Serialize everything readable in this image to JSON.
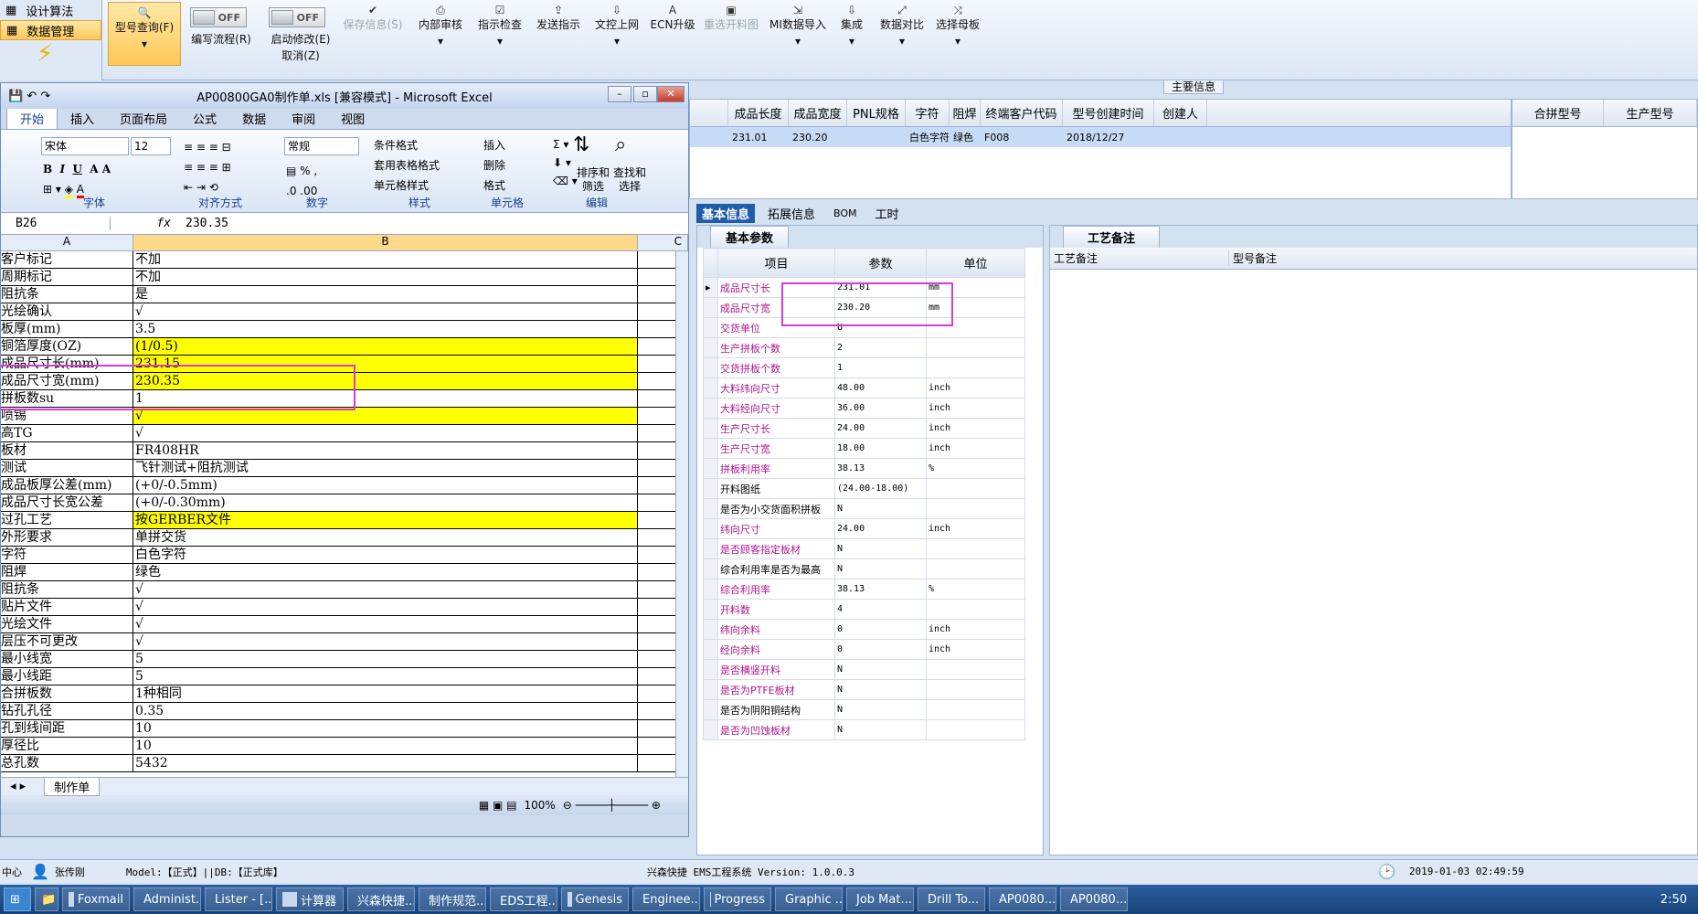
{
  "nav": {
    "items": [
      {
        "label": "设计算法"
      },
      {
        "label": "数据管理"
      }
    ]
  },
  "ribbon": {
    "query": "型号查询(F)",
    "write_flow": "编写流程(R)",
    "start_modify": "启动修改(E)",
    "cancel": "取消(Z)",
    "off": "OFF",
    "save": "保存信息(S)",
    "internal_review": "内部审核",
    "guide_check": "指示检查",
    "send_guide": "发送指示",
    "upload": "文控上网",
    "ecn": "ECN升级",
    "resend": "重选开料图",
    "mi_import": "MI数据导入",
    "integrate": "集成",
    "compare": "数据对比",
    "mother": "选择母板"
  },
  "main_info": "主要信息",
  "top_grid": {
    "headers": [
      "成品长度",
      "成品宽度",
      "PNL规格",
      "字符",
      "阻焊",
      "终端客户代码",
      "型号创建时间",
      "创建人"
    ],
    "row": [
      "231.01",
      "230.20",
      "",
      "白色字符",
      "绿色",
      "F008",
      "2018/12/27",
      ""
    ],
    "right_headers": [
      "合拼型号",
      "生产型号"
    ]
  },
  "tabs": [
    "基本信息",
    "拓展信息",
    "BOM",
    "工时"
  ],
  "basic": {
    "caption": "基本参数",
    "headers": [
      "项目",
      "参数",
      "单位"
    ],
    "rows": [
      {
        "k": "成品尺寸长",
        "v": "231.01",
        "u": "mm",
        "c": "p"
      },
      {
        "k": "成品尺寸宽",
        "v": "230.20",
        "u": "mm",
        "c": "p"
      },
      {
        "k": "交货单位",
        "v": "U",
        "u": "",
        "c": "p"
      },
      {
        "k": "生产拼板个数",
        "v": "2",
        "u": "",
        "c": "p"
      },
      {
        "k": "交货拼板个数",
        "v": "1",
        "u": "",
        "c": "p"
      },
      {
        "k": "大料纬向尺寸",
        "v": "48.00",
        "u": "inch",
        "c": "p"
      },
      {
        "k": "大料经向尺寸",
        "v": "36.00",
        "u": "inch",
        "c": "p"
      },
      {
        "k": "生产尺寸长",
        "v": "24.00",
        "u": "inch",
        "c": "p"
      },
      {
        "k": "生产尺寸宽",
        "v": "18.00",
        "u": "inch",
        "c": "p"
      },
      {
        "k": "拼板利用率",
        "v": "38.13",
        "u": "%",
        "c": "p"
      },
      {
        "k": "开料图纸",
        "v": "(24.00-18.00)",
        "u": "",
        "c": "b"
      },
      {
        "k": "是否为小交货面积拼板",
        "v": "N",
        "u": "",
        "c": "b"
      },
      {
        "k": "纬向尺寸",
        "v": "24.00",
        "u": "inch",
        "c": "p"
      },
      {
        "k": "是否顾客指定板材",
        "v": "N",
        "u": "",
        "c": "p"
      },
      {
        "k": "综合利用率是否为最高",
        "v": "N",
        "u": "",
        "c": "b"
      },
      {
        "k": "综合利用率",
        "v": "38.13",
        "u": "%",
        "c": "p"
      },
      {
        "k": "开料数",
        "v": "4",
        "u": "",
        "c": "p"
      },
      {
        "k": "纬向余料",
        "v": "0",
        "u": "inch",
        "c": "p"
      },
      {
        "k": "经向余料",
        "v": "0",
        "u": "inch",
        "c": "p"
      },
      {
        "k": "是否横竖开料",
        "v": "N",
        "u": "",
        "c": "p"
      },
      {
        "k": "是否为PTFE板材",
        "v": "N",
        "u": "",
        "c": "p"
      },
      {
        "k": "是否为阴阳铜结构",
        "v": "N",
        "u": "",
        "c": "b"
      },
      {
        "k": "是否为凹蚀板材",
        "v": "N",
        "u": "",
        "c": "p"
      }
    ]
  },
  "process": {
    "caption": "工艺备注",
    "col1": "工艺备注",
    "col2": "型号备注"
  },
  "excel": {
    "title": "AP00800GA0制作单.xls [兼容模式] - Microsoft Excel",
    "tabs": [
      "开始",
      "插入",
      "页面布局",
      "公式",
      "数据",
      "审阅",
      "视图"
    ],
    "font": "宋体",
    "size": "12",
    "format": "常规",
    "groups": [
      "字体",
      "对齐方式",
      "数字",
      "样式",
      "单元格",
      "编辑"
    ],
    "style_items": [
      "条件格式",
      "套用表格格式",
      "单元格样式"
    ],
    "cell_items": [
      "插入",
      "删除",
      "格式"
    ],
    "edit_items": [
      "排序和筛选",
      "查找和选择"
    ],
    "namebox": "B26",
    "fx": "fx",
    "formula": "230.35",
    "cols": [
      "A",
      "B",
      "C"
    ],
    "rows": [
      {
        "a": "客户标记",
        "b": "不加",
        "y": false
      },
      {
        "a": "周期标记",
        "b": "不加",
        "y": false
      },
      {
        "a": "阻抗条",
        "b": "是",
        "y": false
      },
      {
        "a": "光绘确认",
        "b": "√",
        "y": false
      },
      {
        "a": "板厚(mm)",
        "b": "3.5",
        "y": false
      },
      {
        "a": "铜箔厚度(OZ)",
        "b": " (1/0.5)",
        "y": true
      },
      {
        "a": "成品尺寸长(mm)",
        "b": "231.15",
        "y": true
      },
      {
        "a": "成品尺寸宽(mm)",
        "b": "230.35",
        "y": true
      },
      {
        "a": "拼板数su",
        "b": "1",
        "y": false
      },
      {
        "a": "喷锡",
        "b": "√",
        "y": true
      },
      {
        "a": "高TG",
        "b": "√",
        "y": false
      },
      {
        "a": "板材",
        "b": "FR408HR",
        "y": false
      },
      {
        "a": "测试",
        "b": "飞针测试+阻抗测试",
        "y": false
      },
      {
        "a": "成品板厚公差(mm)",
        "b": "(+0/-0.5mm)",
        "y": false
      },
      {
        "a": "成品尺寸长宽公差",
        "b": "(+0/-0.30mm)",
        "y": false
      },
      {
        "a": "过孔工艺",
        "b": "按GERBER文件",
        "y": true
      },
      {
        "a": "外形要求",
        "b": "单拼交货",
        "y": false
      },
      {
        "a": "字符",
        "b": "白色字符",
        "y": false
      },
      {
        "a": "阻焊",
        "b": "绿色",
        "y": false
      },
      {
        "a": "阻抗条",
        "b": "√",
        "y": false
      },
      {
        "a": "贴片文件",
        "b": "√",
        "y": false
      },
      {
        "a": "光绘文件",
        "b": "√",
        "y": false
      },
      {
        "a": "层压不可更改",
        "b": "√",
        "y": false
      },
      {
        "a": "最小线宽",
        "b": "5",
        "y": false
      },
      {
        "a": "最小线距",
        "b": "5",
        "y": false
      },
      {
        "a": "合拼板数",
        "b": "1种相同",
        "y": false
      },
      {
        "a": "钻孔孔径",
        "b": "0.35",
        "y": false
      },
      {
        "a": "孔到线间距",
        "b": "10",
        "y": false
      },
      {
        "a": "厚径比",
        "b": "10",
        "y": false
      },
      {
        "a": "总孔数",
        "b": "5432",
        "y": false
      }
    ],
    "sheet": "制作单",
    "zoom": "100%"
  },
  "status": {
    "left": "中心",
    "user": "张传刚",
    "model": "Model:【正式】||DB:【正式库】",
    "system": "兴森快捷 EMS工程系统 Version: 1.0.0.3",
    "datetime": "2019-01-03 02:49:59"
  },
  "taskbar": {
    "items": [
      "Foxmail",
      "Administ...",
      "Lister - [...",
      "计算器",
      "兴森快捷...",
      "制作规范...",
      "EDS工程...",
      "Genesis",
      "Enginee...",
      "Progress",
      "Graphic ...",
      "Job Mat...",
      "Drill To...",
      "AP0080...",
      "AP0080..."
    ],
    "clock": "2:50"
  },
  "colors": {
    "accent": "#1f5da8",
    "highlight": "#d83ad8",
    "yellow": "#ffff00",
    "param_key": "#b0168f"
  }
}
